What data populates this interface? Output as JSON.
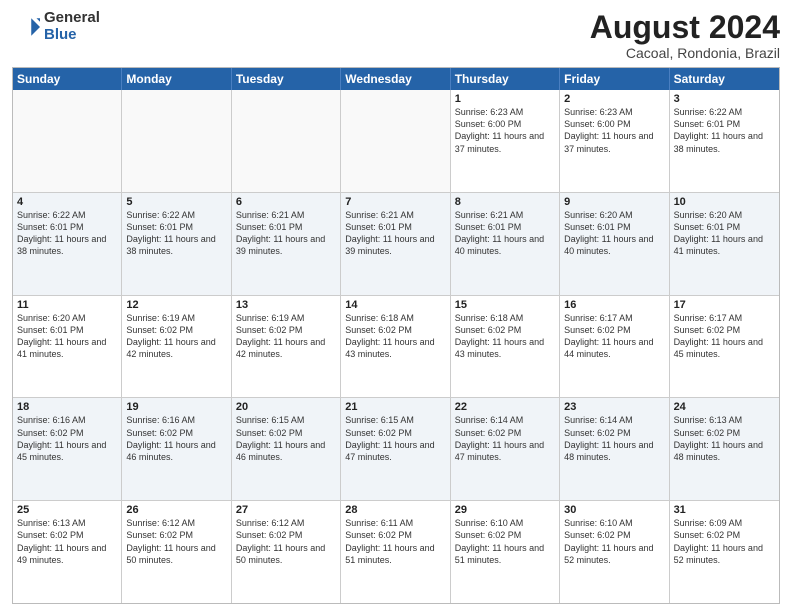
{
  "logo": {
    "general": "General",
    "blue": "Blue"
  },
  "title": "August 2024",
  "location": "Cacoal, Rondonia, Brazil",
  "days_of_week": [
    "Sunday",
    "Monday",
    "Tuesday",
    "Wednesday",
    "Thursday",
    "Friday",
    "Saturday"
  ],
  "rows": [
    [
      {
        "day": "",
        "empty": true
      },
      {
        "day": "",
        "empty": true
      },
      {
        "day": "",
        "empty": true
      },
      {
        "day": "",
        "empty": true
      },
      {
        "day": "1",
        "sunrise": "6:23 AM",
        "sunset": "6:00 PM",
        "daylight": "11 hours and 37 minutes."
      },
      {
        "day": "2",
        "sunrise": "6:23 AM",
        "sunset": "6:00 PM",
        "daylight": "11 hours and 37 minutes."
      },
      {
        "day": "3",
        "sunrise": "6:22 AM",
        "sunset": "6:01 PM",
        "daylight": "11 hours and 38 minutes."
      }
    ],
    [
      {
        "day": "4",
        "sunrise": "6:22 AM",
        "sunset": "6:01 PM",
        "daylight": "11 hours and 38 minutes."
      },
      {
        "day": "5",
        "sunrise": "6:22 AM",
        "sunset": "6:01 PM",
        "daylight": "11 hours and 38 minutes."
      },
      {
        "day": "6",
        "sunrise": "6:21 AM",
        "sunset": "6:01 PM",
        "daylight": "11 hours and 39 minutes."
      },
      {
        "day": "7",
        "sunrise": "6:21 AM",
        "sunset": "6:01 PM",
        "daylight": "11 hours and 39 minutes."
      },
      {
        "day": "8",
        "sunrise": "6:21 AM",
        "sunset": "6:01 PM",
        "daylight": "11 hours and 40 minutes."
      },
      {
        "day": "9",
        "sunrise": "6:20 AM",
        "sunset": "6:01 PM",
        "daylight": "11 hours and 40 minutes."
      },
      {
        "day": "10",
        "sunrise": "6:20 AM",
        "sunset": "6:01 PM",
        "daylight": "11 hours and 41 minutes."
      }
    ],
    [
      {
        "day": "11",
        "sunrise": "6:20 AM",
        "sunset": "6:01 PM",
        "daylight": "11 hours and 41 minutes."
      },
      {
        "day": "12",
        "sunrise": "6:19 AM",
        "sunset": "6:02 PM",
        "daylight": "11 hours and 42 minutes."
      },
      {
        "day": "13",
        "sunrise": "6:19 AM",
        "sunset": "6:02 PM",
        "daylight": "11 hours and 42 minutes."
      },
      {
        "day": "14",
        "sunrise": "6:18 AM",
        "sunset": "6:02 PM",
        "daylight": "11 hours and 43 minutes."
      },
      {
        "day": "15",
        "sunrise": "6:18 AM",
        "sunset": "6:02 PM",
        "daylight": "11 hours and 43 minutes."
      },
      {
        "day": "16",
        "sunrise": "6:17 AM",
        "sunset": "6:02 PM",
        "daylight": "11 hours and 44 minutes."
      },
      {
        "day": "17",
        "sunrise": "6:17 AM",
        "sunset": "6:02 PM",
        "daylight": "11 hours and 45 minutes."
      }
    ],
    [
      {
        "day": "18",
        "sunrise": "6:16 AM",
        "sunset": "6:02 PM",
        "daylight": "11 hours and 45 minutes."
      },
      {
        "day": "19",
        "sunrise": "6:16 AM",
        "sunset": "6:02 PM",
        "daylight": "11 hours and 46 minutes."
      },
      {
        "day": "20",
        "sunrise": "6:15 AM",
        "sunset": "6:02 PM",
        "daylight": "11 hours and 46 minutes."
      },
      {
        "day": "21",
        "sunrise": "6:15 AM",
        "sunset": "6:02 PM",
        "daylight": "11 hours and 47 minutes."
      },
      {
        "day": "22",
        "sunrise": "6:14 AM",
        "sunset": "6:02 PM",
        "daylight": "11 hours and 47 minutes."
      },
      {
        "day": "23",
        "sunrise": "6:14 AM",
        "sunset": "6:02 PM",
        "daylight": "11 hours and 48 minutes."
      },
      {
        "day": "24",
        "sunrise": "6:13 AM",
        "sunset": "6:02 PM",
        "daylight": "11 hours and 48 minutes."
      }
    ],
    [
      {
        "day": "25",
        "sunrise": "6:13 AM",
        "sunset": "6:02 PM",
        "daylight": "11 hours and 49 minutes."
      },
      {
        "day": "26",
        "sunrise": "6:12 AM",
        "sunset": "6:02 PM",
        "daylight": "11 hours and 50 minutes."
      },
      {
        "day": "27",
        "sunrise": "6:12 AM",
        "sunset": "6:02 PM",
        "daylight": "11 hours and 50 minutes."
      },
      {
        "day": "28",
        "sunrise": "6:11 AM",
        "sunset": "6:02 PM",
        "daylight": "11 hours and 51 minutes."
      },
      {
        "day": "29",
        "sunrise": "6:10 AM",
        "sunset": "6:02 PM",
        "daylight": "11 hours and 51 minutes."
      },
      {
        "day": "30",
        "sunrise": "6:10 AM",
        "sunset": "6:02 PM",
        "daylight": "11 hours and 52 minutes."
      },
      {
        "day": "31",
        "sunrise": "6:09 AM",
        "sunset": "6:02 PM",
        "daylight": "11 hours and 52 minutes."
      }
    ]
  ],
  "labels": {
    "sunrise": "Sunrise:",
    "sunset": "Sunset:",
    "daylight": "Daylight hours"
  }
}
